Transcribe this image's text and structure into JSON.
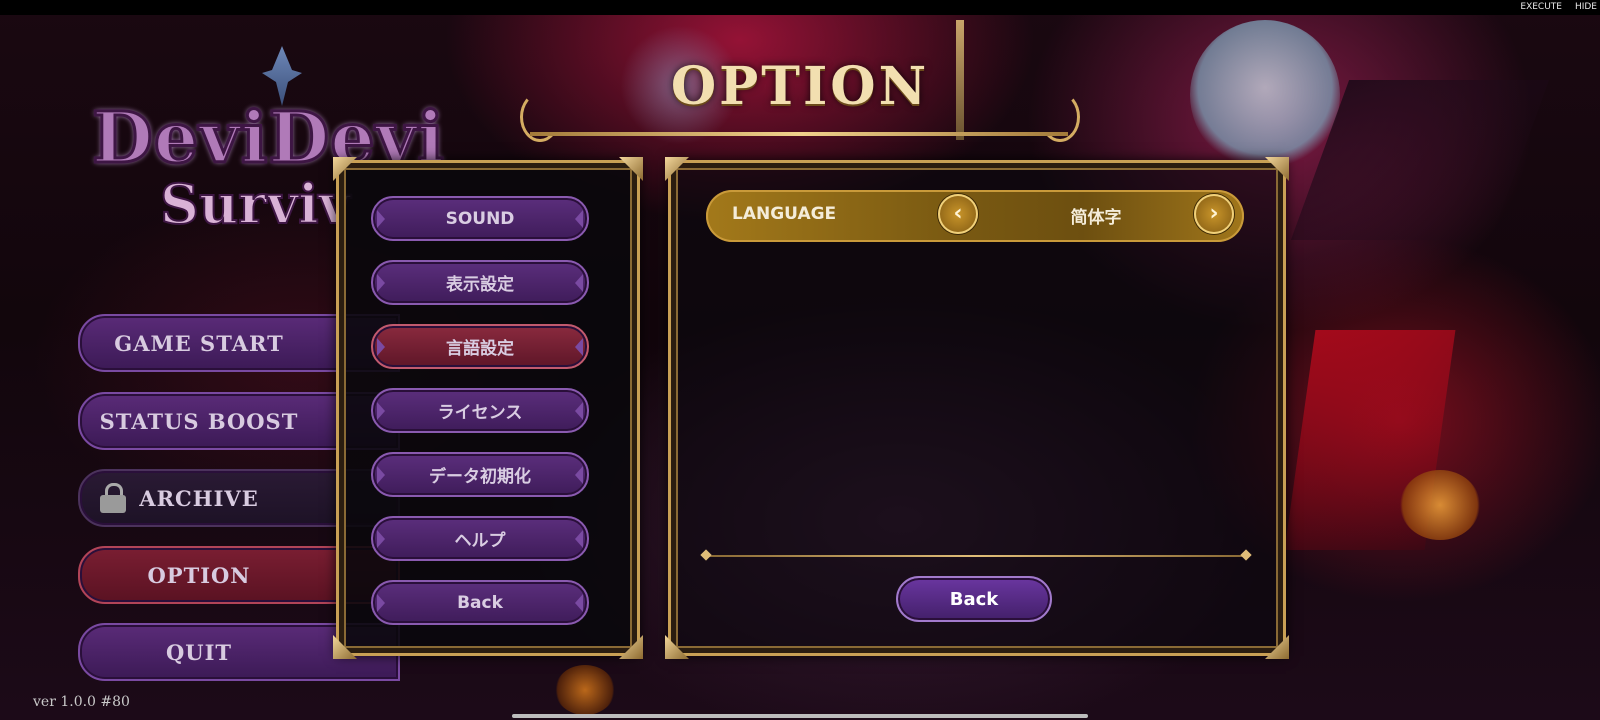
{
  "topbar": {
    "execute": "EXECUTE",
    "hide": "HIDE"
  },
  "logo": {
    "line1": "DeviDevi",
    "line2": "Surviv"
  },
  "main_menu": {
    "items": [
      {
        "label": "GAME START"
      },
      {
        "label": "STATUS BOOST"
      },
      {
        "label": "ARCHIVE",
        "locked": true
      },
      {
        "label": "OPTION",
        "active": true
      },
      {
        "label": "QUIT"
      }
    ]
  },
  "version": "ver 1.0.0 #80",
  "option": {
    "title": "OPTION",
    "submenu": [
      {
        "label": "SOUND"
      },
      {
        "label": "表示設定"
      },
      {
        "label": "言語設定",
        "active": true
      },
      {
        "label": "ライセンス"
      },
      {
        "label": "データ初期化"
      },
      {
        "label": "ヘルプ"
      },
      {
        "label": "Back"
      }
    ],
    "language": {
      "label": "LANGUAGE",
      "value": "简体字",
      "prev_icon": "chevron-left-icon",
      "next_icon": "chevron-right-icon"
    },
    "back_label": "Back"
  },
  "colors": {
    "accent_gold": "#c9a055",
    "menu_purple": "#5a2b78",
    "active_red": "#7a1e32",
    "language_bar": "#a3791a"
  }
}
